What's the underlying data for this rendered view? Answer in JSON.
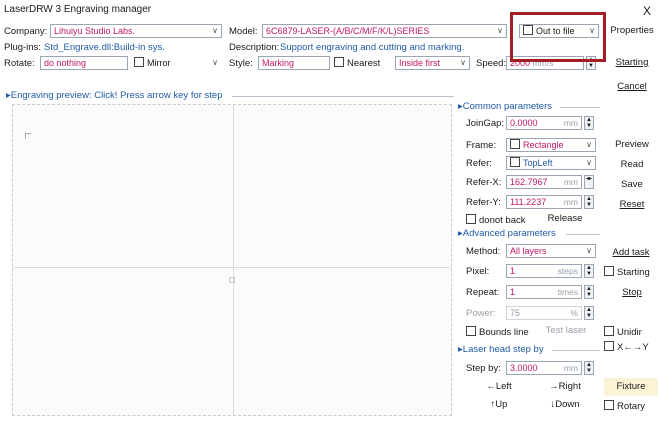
{
  "window": {
    "title": "LaserDRW 3 Engraving manager",
    "close": "X"
  },
  "top": {
    "company_label": "Company:",
    "company_value": "Lihuiyu Studio Labs.",
    "model_label": "Model:",
    "model_value": "6C6879-LASER-(A/B/C/M/F/K/L)SERIES",
    "out_to_file": "Out to file",
    "properties": "Properties",
    "plugins_label": "Plug-ins:",
    "plugins_value": "Std_Engrave.dll:Build-in sys.",
    "description_label": "Description:",
    "description_value": "Support engraving and cutting and marking.",
    "rotate_label": "Rotate:",
    "rotate_value": "do nothing",
    "mirror": "Mirror",
    "style_label": "Style:",
    "style_value": "Marking",
    "nearest": "Nearest",
    "inside_first": "Inside first",
    "speed_label": "Speed:",
    "speed_value": "2000",
    "speed_unit": "mm/s",
    "starting": "Starting",
    "cancel": "Cancel"
  },
  "preview": {
    "header": "Engraving preview: Click! Press arrow key for step"
  },
  "common": {
    "header": "Common parameters",
    "joingap_label": "JoinGap:",
    "joingap_value": "0.0000",
    "joingap_unit": "mm",
    "frame_label": "Frame:",
    "frame_value": "Rectangle",
    "refer_label": "Refer:",
    "refer_value": "TopLeft",
    "referx_label": "Refer-X:",
    "referx_value": "162.7967",
    "referx_unit": "mm",
    "refery_label": "Refer-Y:",
    "refery_value": "111.2237",
    "refery_unit": "mm",
    "donot_back": "donot back",
    "release": "Release"
  },
  "advanced": {
    "header": "Advanced parameters",
    "method_label": "Method:",
    "method_value": "All layers",
    "pixel_label": "Pixel:",
    "pixel_value": "1",
    "pixel_unit": "steps",
    "repeat_label": "Repeat:",
    "repeat_value": "1",
    "repeat_unit": "times",
    "power_label": "Power:",
    "power_value": "75",
    "power_unit": "%",
    "bounds_line": "Bounds line",
    "test_laser": "Test laser"
  },
  "step": {
    "header": "Laser head step by",
    "stepby_label": "Step by:",
    "stepby_value": "3.0000",
    "stepby_unit": "mm",
    "left": "←Left",
    "right": "→Right",
    "up": "↑Up",
    "down": "↓Down"
  },
  "right_buttons": {
    "preview": "Preview",
    "read": "Read",
    "save": "Save",
    "reset": "Reset",
    "add_task": "Add task",
    "starting": "Starting",
    "stop": "Stop",
    "unidir": "Unidir",
    "xy": "X←→Y",
    "fixture": "Fixture",
    "rotary": "Rotary"
  }
}
